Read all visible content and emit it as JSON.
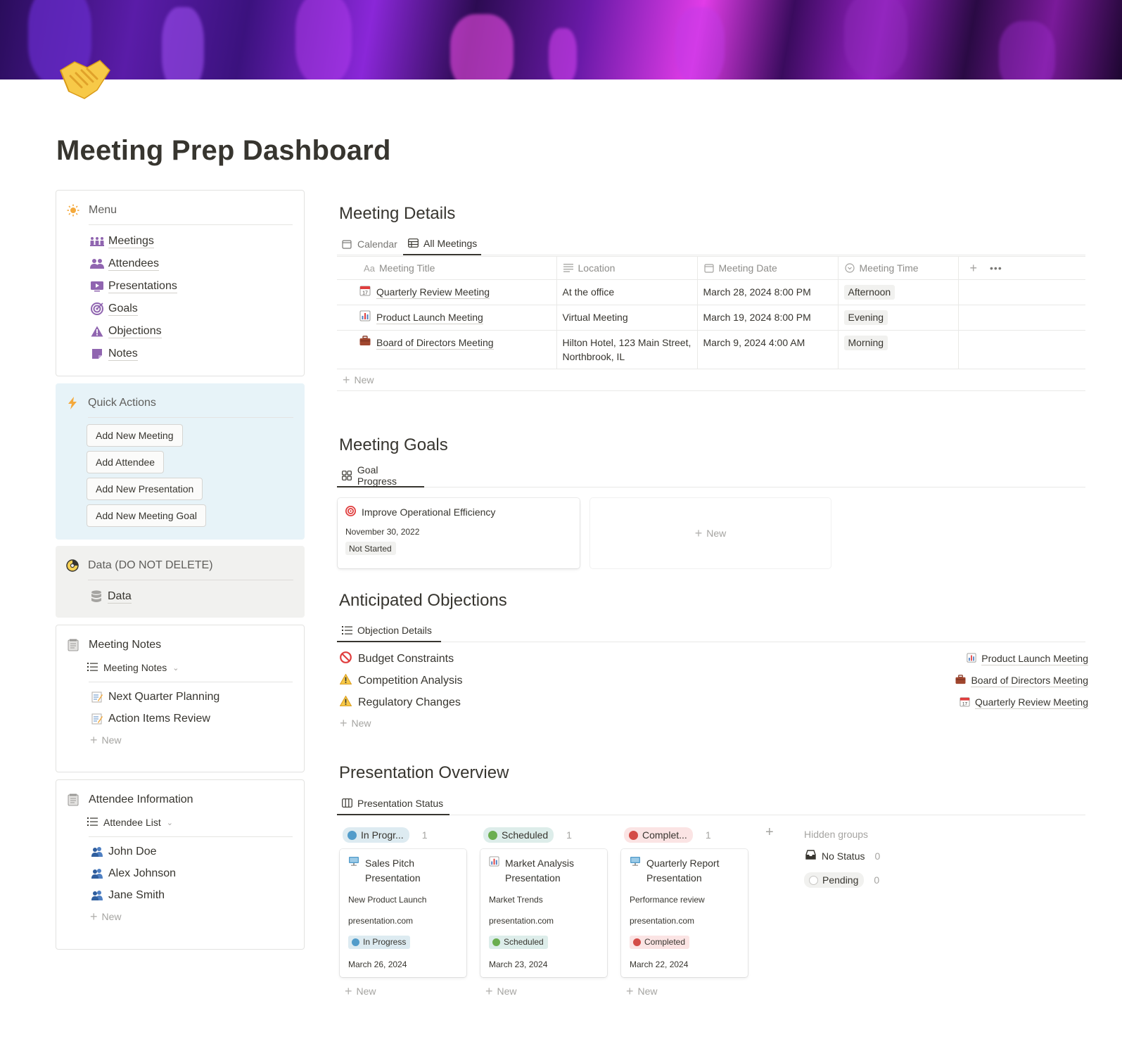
{
  "page": {
    "title": "Meeting Prep Dashboard"
  },
  "menu": {
    "title": "Menu",
    "items": [
      {
        "label": "Meetings",
        "icon": "calendar-people-icon"
      },
      {
        "label": "Attendees",
        "icon": "people-icon"
      },
      {
        "label": "Presentations",
        "icon": "presentation-icon"
      },
      {
        "label": "Goals",
        "icon": "target-icon"
      },
      {
        "label": "Objections",
        "icon": "warning-icon"
      },
      {
        "label": "Notes",
        "icon": "sticky-note-icon"
      }
    ]
  },
  "quick_actions": {
    "title": "Quick Actions",
    "buttons": [
      "Add New Meeting",
      "Add Attendee",
      "Add New Presentation",
      "Add New Meeting Goal"
    ]
  },
  "data_section": {
    "title": "Data (DO NOT DELETE)",
    "item": "Data"
  },
  "meeting_notes": {
    "title": "Meeting Notes",
    "view": "Meeting Notes",
    "items": [
      "Next Quarter Planning",
      "Action Items Review"
    ],
    "new_label": "New"
  },
  "attendee_info": {
    "title": "Attendee Information",
    "view": "Attendee List",
    "items": [
      "John Doe",
      "Alex Johnson",
      "Jane Smith"
    ],
    "new_label": "New"
  },
  "meeting_details": {
    "title": "Meeting Details",
    "tabs": [
      "Calendar",
      "All Meetings"
    ],
    "columns": [
      "Meeting Title",
      "Location",
      "Meeting Date",
      "Meeting Time"
    ],
    "rows": [
      {
        "title": "Quarterly Review Meeting",
        "location": "At the office",
        "date": "March 28, 2024 8:00 PM",
        "time": "Afternoon"
      },
      {
        "title": "Product Launch Meeting",
        "location": "Virtual Meeting",
        "date": "March 19, 2024 8:00 PM",
        "time": "Evening"
      },
      {
        "title": "Board of Directors Meeting",
        "location": "Hilton Hotel, 123 Main Street, Northbrook, IL",
        "date": "March 9, 2024 4:00 AM",
        "time": "Morning"
      }
    ],
    "new_label": "New"
  },
  "meeting_goals": {
    "title": "Meeting Goals",
    "tab": "Goal Progress",
    "card": {
      "title": "Improve Operational Efficiency",
      "date": "November 30, 2022",
      "status": "Not Started"
    },
    "new_label": "New"
  },
  "objections": {
    "title": "Anticipated Objections",
    "tab": "Objection Details",
    "rows": [
      {
        "name": "Budget Constraints",
        "icon": "prohibited-icon",
        "meeting": "Product Launch Meeting",
        "meeting_icon": "bar-chart-icon"
      },
      {
        "name": "Competition Analysis",
        "icon": "warning-icon",
        "meeting": "Board of Directors Meeting",
        "meeting_icon": "briefcase-icon"
      },
      {
        "name": "Regulatory Changes",
        "icon": "warning-icon",
        "meeting": "Quarterly Review Meeting",
        "meeting_icon": "calendar-icon"
      }
    ],
    "new_label": "New"
  },
  "presentations": {
    "title": "Presentation Overview",
    "tab": "Presentation Status",
    "groups": [
      {
        "label": "In Progr...",
        "count": "1",
        "color": "#529cca",
        "card": {
          "title": "Sales Pitch Presentation",
          "topic": "New Product Launch",
          "link": "presentation.com",
          "status": "In Progress",
          "date": "March 26, 2024"
        }
      },
      {
        "label": "Scheduled",
        "count": "1",
        "color": "#6aae4f",
        "card": {
          "title": "Market Analysis Presentation",
          "topic": "Market Trends",
          "link": "presentation.com",
          "status": "Scheduled",
          "date": "March 23, 2024"
        }
      },
      {
        "label": "Complet...",
        "count": "1",
        "color": "#d44c47",
        "card": {
          "title": "Quarterly Report Presentation",
          "topic": "Performance review",
          "link": "presentation.com",
          "status": "Completed",
          "date": "March 22, 2024"
        }
      }
    ],
    "hidden_groups": {
      "title": "Hidden groups",
      "items": [
        {
          "label": "No Status",
          "count": "0"
        },
        {
          "label": "Pending",
          "count": "0"
        }
      ]
    },
    "new_label": "New"
  }
}
